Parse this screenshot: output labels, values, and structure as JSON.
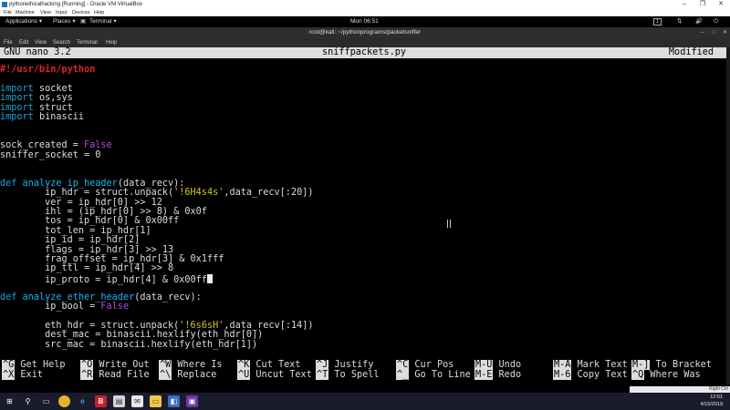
{
  "vbox": {
    "title": "pythonethicalhacking [Running] - Oracle VM VirtualBox",
    "menu": [
      "File",
      "Machine",
      "View",
      "Input",
      "Devices",
      "Help"
    ],
    "win_buttons": [
      "–",
      "❐",
      "✕"
    ]
  },
  "gnome": {
    "applications": "Applications ▾",
    "places": "Places ▾",
    "terminal": "Terminal ▾",
    "clock": "Mon 06:51",
    "workspace": "1"
  },
  "terminal": {
    "title": "root@kali: ~/pythonprograms/packetsniffer",
    "menu": [
      "File",
      "Edit",
      "View",
      "Search",
      "Terminal",
      "Help"
    ]
  },
  "nano": {
    "version": "GNU nano 3.2",
    "filename": "sniffpackets.py",
    "status": "Modified"
  },
  "code_lines": [
    {
      "row": 0,
      "parts": [
        [
          "shebang",
          "#!/usr/bin/python"
        ]
      ]
    },
    {
      "row": 2,
      "parts": [
        [
          "kw",
          "import"
        ],
        [
          "",
          " socket"
        ]
      ]
    },
    {
      "row": 3,
      "parts": [
        [
          "kw",
          "import"
        ],
        [
          "",
          " os,sys"
        ]
      ]
    },
    {
      "row": 4,
      "parts": [
        [
          "kw",
          "import"
        ],
        [
          "",
          " struct"
        ]
      ]
    },
    {
      "row": 5,
      "parts": [
        [
          "kw",
          "import"
        ],
        [
          "",
          " binascii"
        ]
      ]
    },
    {
      "row": 8,
      "parts": [
        [
          "",
          "sock_created = "
        ],
        [
          "bool",
          "False"
        ]
      ]
    },
    {
      "row": 9,
      "parts": [
        [
          "",
          "sniffer_socket = 0"
        ]
      ]
    },
    {
      "row": 12,
      "parts": [
        [
          "kw",
          "def"
        ],
        [
          "",
          " "
        ],
        [
          "fn",
          "analyze_ip_header"
        ],
        [
          "",
          "(data_recv):"
        ]
      ]
    },
    {
      "row": 13,
      "parts": [
        [
          "",
          "        ip_hdr = struct.unpack("
        ],
        [
          "str",
          "'!6H4s4s'"
        ],
        [
          "",
          ",data_recv[:20])"
        ]
      ]
    },
    {
      "row": 14,
      "parts": [
        [
          "",
          "        ver = ip_hdr[0] >> 12"
        ]
      ]
    },
    {
      "row": 15,
      "parts": [
        [
          "",
          "        ihl = (ip_hdr[0] >> 8) & 0x0f"
        ]
      ]
    },
    {
      "row": 16,
      "parts": [
        [
          "",
          "        tos = ip_hdr[0] & 0x00ff"
        ]
      ]
    },
    {
      "row": 17,
      "parts": [
        [
          "",
          "        tot_len = ip_hdr[1]"
        ]
      ]
    },
    {
      "row": 18,
      "parts": [
        [
          "",
          "        ip_id = ip_hdr[2]"
        ]
      ]
    },
    {
      "row": 19,
      "parts": [
        [
          "",
          "        flags = ip_hdr[3] >> 13"
        ]
      ]
    },
    {
      "row": 20,
      "parts": [
        [
          "",
          "        frag_offset = ip_hdr[3] & 0x1fff"
        ]
      ]
    },
    {
      "row": 21,
      "parts": [
        [
          "",
          "        ip_ttl = ip_hdr[4] >> 8"
        ]
      ]
    },
    {
      "row": 22,
      "parts": [
        [
          "",
          "        ip_proto = ip_hdr[4] & 0x00ff"
        ]
      ],
      "cursor": true
    },
    {
      "row": 24,
      "parts": [
        [
          "kw",
          "def"
        ],
        [
          "",
          " "
        ],
        [
          "fn",
          "analyze_ether_header"
        ],
        [
          "",
          "(data_recv):"
        ]
      ]
    },
    {
      "row": 25,
      "parts": [
        [
          "",
          "        ip_bool = "
        ],
        [
          "bool",
          "False"
        ]
      ]
    },
    {
      "row": 27,
      "parts": [
        [
          "",
          "        eth_hdr = struct.unpack("
        ],
        [
          "str",
          "'!6s6sH'"
        ],
        [
          "",
          ",data_recv[:14])"
        ]
      ]
    },
    {
      "row": 28,
      "parts": [
        [
          "",
          "        dest_mac = binascii.hexlify(eth_hdr[0])"
        ]
      ]
    },
    {
      "row": 29,
      "parts": [
        [
          "",
          "        src_mac = binascii.hexlify(eth_hdr[1])"
        ]
      ]
    }
  ],
  "shortcuts": [
    {
      "key": "^G",
      "label": "Get Help"
    },
    {
      "key": "^O",
      "label": "Write Out"
    },
    {
      "key": "^W",
      "label": "Where Is"
    },
    {
      "key": "^K",
      "label": "Cut Text"
    },
    {
      "key": "^J",
      "label": "Justify"
    },
    {
      "key": "^C",
      "label": "Cur Pos"
    },
    {
      "key": "M-U",
      "label": "Undo"
    },
    {
      "key": "M-A",
      "label": "Mark Text"
    },
    {
      "key": "M-]",
      "label": "To Bracket"
    },
    {
      "key": "^X",
      "label": "Exit"
    },
    {
      "key": "^R",
      "label": "Read File"
    },
    {
      "key": "^\\",
      "label": "Replace"
    },
    {
      "key": "^U",
      "label": "Uncut Text"
    },
    {
      "key": "^T",
      "label": "To Spell"
    },
    {
      "key": "^_",
      "label": "Go To Line"
    },
    {
      "key": "M-E",
      "label": "Redo"
    },
    {
      "key": "M-6",
      "label": "Copy Text"
    },
    {
      "key": "^Q",
      "label": "Where Was"
    }
  ],
  "host": {
    "status": "Right Ctrl",
    "time": "12:51",
    "date": "4/15/2019",
    "taskbar_icons": [
      "windows-icon",
      "search-icon",
      "task-view-icon",
      "chrome-icon",
      "edge-icon",
      "app-icon",
      "store-icon",
      "mail-icon",
      "folder-icon",
      "virtualbox-icon",
      "terminal-icon"
    ]
  },
  "colors": {
    "keyword": "#1fa3d6",
    "function": "#19b6ee",
    "string": "#d1c32a",
    "boolean": "#b14ed8",
    "shebang": "#e02424"
  }
}
